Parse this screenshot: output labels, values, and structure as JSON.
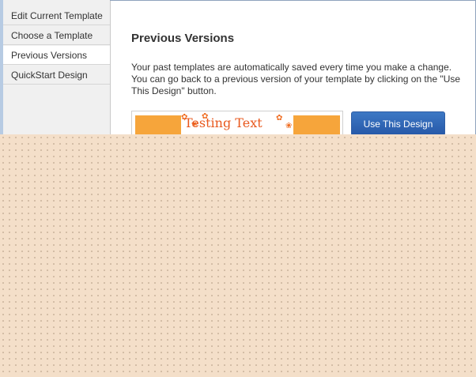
{
  "sidebar": {
    "items": [
      {
        "label": "Edit Current Template"
      },
      {
        "label": "Choose a Template"
      },
      {
        "label": "Previous Versions"
      },
      {
        "label": "QuickStart Design"
      }
    ]
  },
  "main": {
    "title": "Previous Versions",
    "description": "Your past templates are automatically saved every time you make a change. You can go back to a previous version of your template by clicking on the \"Use This Design\" button.",
    "versions": [
      {
        "preview_text": "Testing Text",
        "button_label": "Use This Design"
      }
    ]
  },
  "colors": {
    "accent_button": "#2e63b0",
    "thumbnail_band": "#f6a53b",
    "thumbnail_text": "#e8581d",
    "overlay": "#f4dfc9"
  }
}
